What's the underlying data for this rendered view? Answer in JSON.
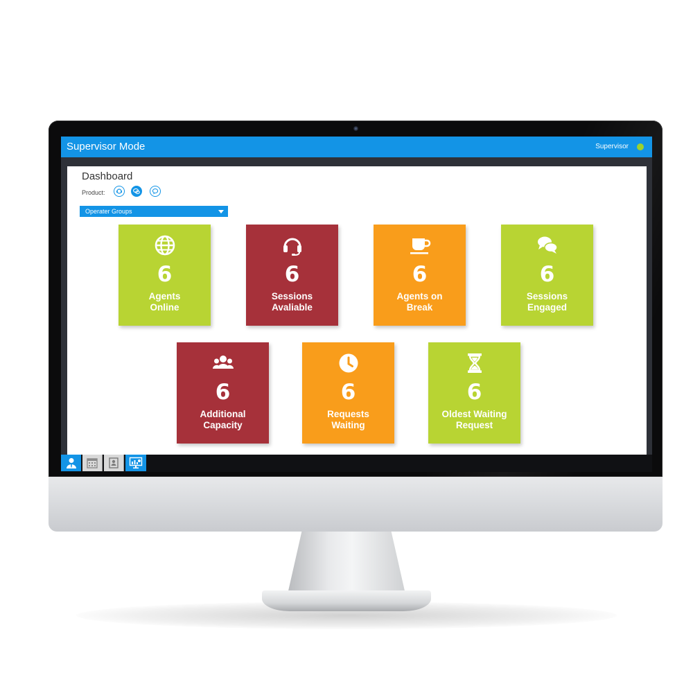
{
  "window": {
    "title": "Supervisor Mode",
    "user_role": "Supervisor",
    "status_color": "#9bd22e",
    "accent_color": "#1394e6"
  },
  "dashboard": {
    "title": "Dashboard",
    "product_label": "Product:",
    "product_icons": [
      "support-agent-icon",
      "chat-bubbles-icon",
      "message-icon"
    ],
    "selected_product_index": 1,
    "group_select": {
      "selected": "Operater Groups"
    }
  },
  "tiles": [
    {
      "value": "6",
      "label_line1": "Agents",
      "label_line2": "Online",
      "icon": "globe-icon",
      "color": "#b8d433"
    },
    {
      "value": "6",
      "label_line1": "Sessions",
      "label_line2": "Avaliable",
      "icon": "headset-icon",
      "color": "#a6313a"
    },
    {
      "value": "6",
      "label_line1": "Agents on",
      "label_line2": "Break",
      "icon": "coffee-cup-icon",
      "color": "#f99d1b"
    },
    {
      "value": "6",
      "label_line1": "Sessions",
      "label_line2": "Engaged",
      "icon": "chat-bubbles-icon",
      "color": "#b8d433"
    },
    {
      "value": "6",
      "label_line1": "Additional",
      "label_line2": "Capacity",
      "icon": "group-icon",
      "color": "#a6313a"
    },
    {
      "value": "6",
      "label_line1": "Requests",
      "label_line2": "Waiting",
      "icon": "clock-icon",
      "color": "#f99d1b"
    },
    {
      "value": "6",
      "label_line1": "Oldest Waiting",
      "label_line2": "Request",
      "icon": "hourglass-icon",
      "color": "#b8d433"
    }
  ],
  "taskbar": {
    "buttons": [
      "user-icon",
      "calendar-icon",
      "contact-card-icon",
      "dashboard-monitor-icon"
    ],
    "active_index": 3
  }
}
